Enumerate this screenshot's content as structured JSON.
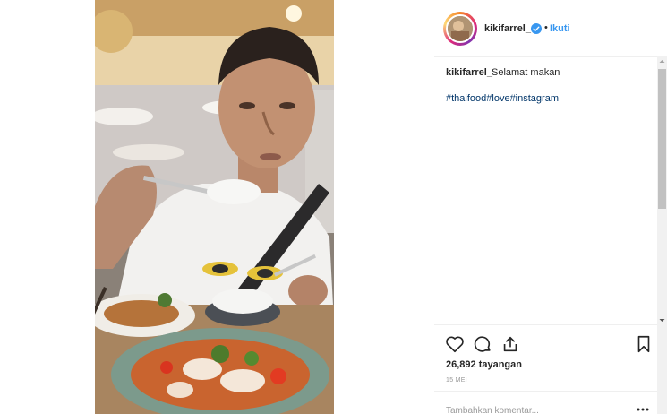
{
  "post": {
    "username": "kikifarrel_",
    "follow_label": "Ikuti",
    "dot": "•",
    "caption_username": "kikifarrel_",
    "caption_text": "Selamat makan",
    "hashtags": [
      "#thaifood",
      "#love",
      "#instagram"
    ],
    "views": "26,892 tayangan",
    "date": "15 MEI",
    "comment_placeholder": "Tambahkan komentar..."
  },
  "icons": {
    "verified": "verified-badge-icon",
    "like": "heart-icon",
    "comment": "comment-icon",
    "share": "share-icon",
    "save": "bookmark-icon",
    "more": "more-icon"
  },
  "colors": {
    "link": "#3897f0",
    "hashtag": "#003569",
    "text": "#262626",
    "muted": "#999999"
  }
}
